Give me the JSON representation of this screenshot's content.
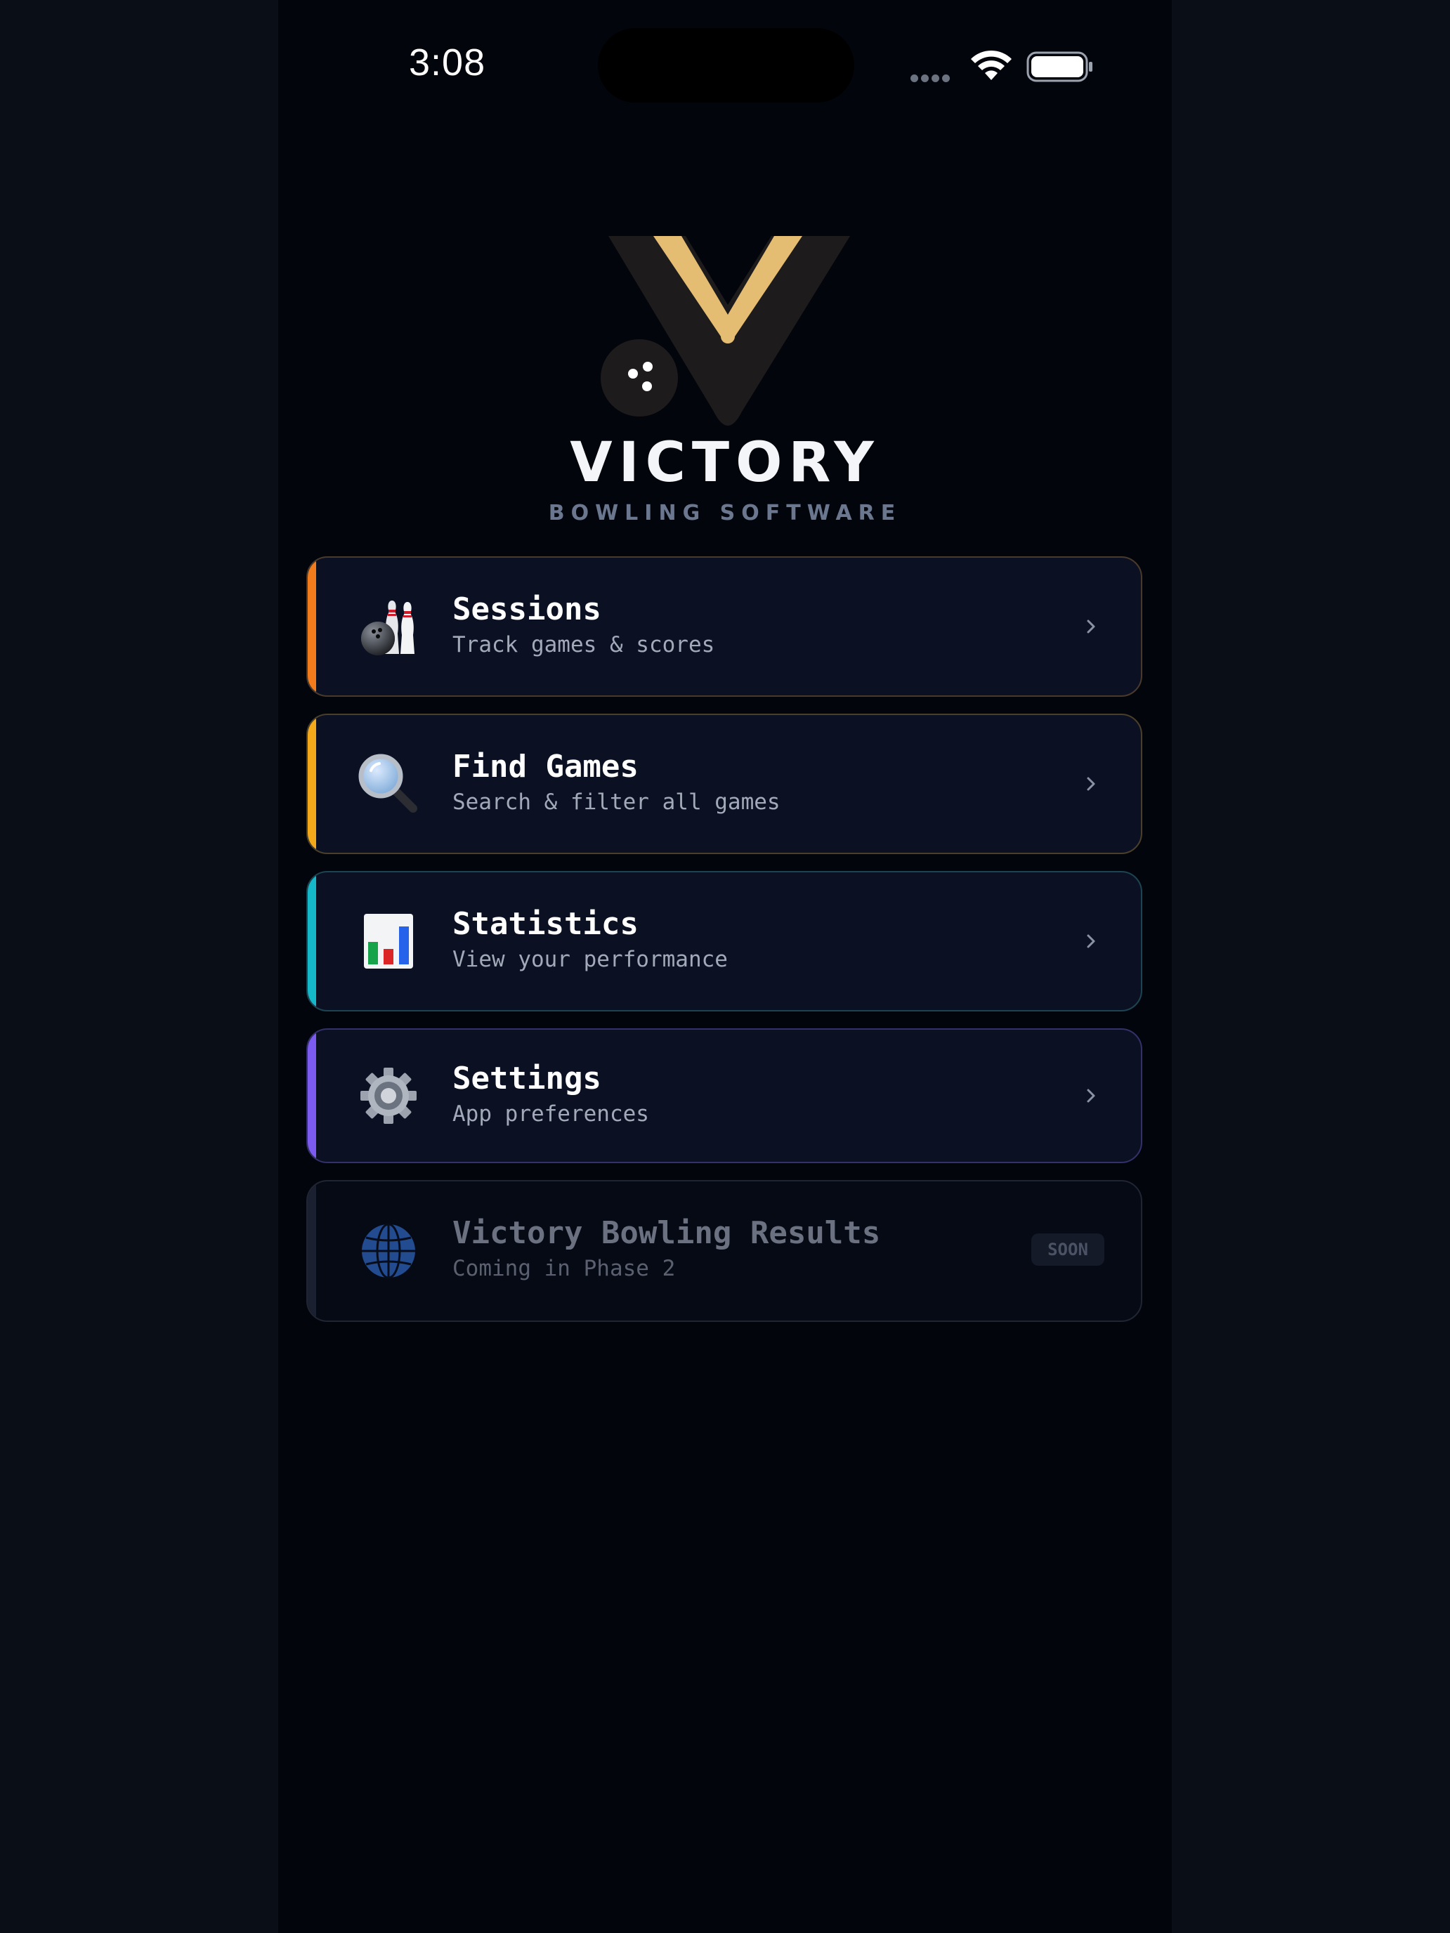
{
  "status_bar": {
    "time": "3:08"
  },
  "brand": {
    "name": "VICTORY",
    "tagline": "BOWLING SOFTWARE",
    "logo_colors": {
      "v_inner": "#e4bd72",
      "v_outer": "#1e1b1c",
      "ball": "#1e1b1c"
    }
  },
  "menu": [
    {
      "id": "sessions",
      "title": "Sessions",
      "subtitle": "Track games & scores",
      "icon": "bowling-icon",
      "accent": "#f27c1b",
      "border": "#4a3a2c",
      "enabled": true
    },
    {
      "id": "find-games",
      "title": "Find Games",
      "subtitle": "Search & filter all games",
      "icon": "magnifier-icon",
      "accent": "#f4a91b",
      "border": "#4a3f2a",
      "enabled": true
    },
    {
      "id": "statistics",
      "title": "Statistics",
      "subtitle": "View your performance",
      "icon": "bar-chart-icon",
      "accent": "#14b8c8",
      "border": "#1d4452",
      "enabled": true
    },
    {
      "id": "settings",
      "title": "Settings",
      "subtitle": "App preferences",
      "icon": "gear-icon",
      "accent": "#7c5cf0",
      "border": "#33306a",
      "enabled": true
    },
    {
      "id": "results",
      "title": "Victory Bowling Results",
      "subtitle": "Coming in Phase 2",
      "icon": "globe-icon",
      "accent": "#1a2030",
      "border": "#1f2533",
      "badge": "SOON",
      "enabled": false
    }
  ]
}
